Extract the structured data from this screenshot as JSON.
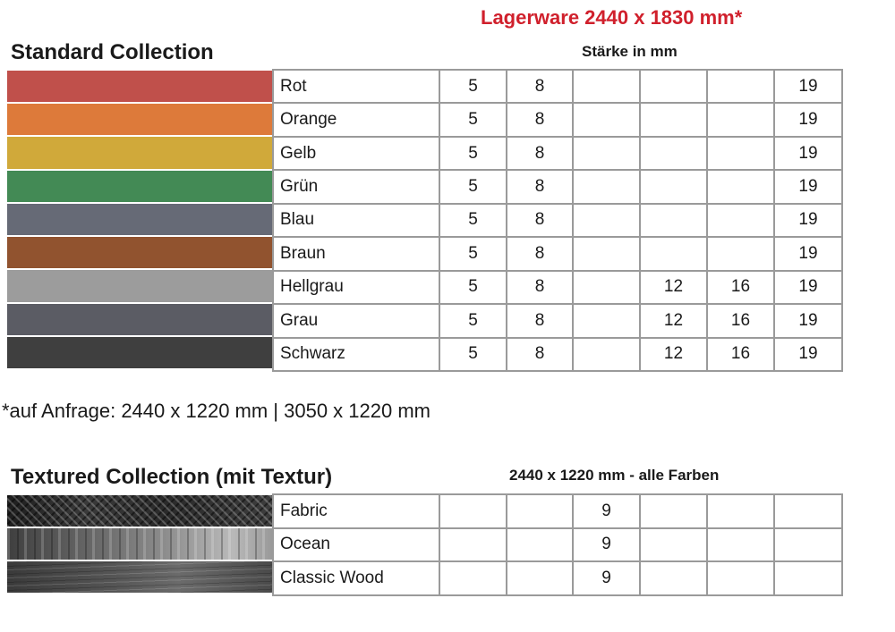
{
  "header": {
    "stock_title": "Lagerware 2440 x 1830 mm*",
    "thickness_label": "Stärke in mm"
  },
  "standard": {
    "title": "Standard Collection",
    "rows": [
      {
        "name": "Rot",
        "swatch": "#c0504b",
        "cells": [
          "5",
          "8",
          "",
          "",
          "",
          "19"
        ]
      },
      {
        "name": "Orange",
        "swatch": "#dd7a3a",
        "cells": [
          "5",
          "8",
          "",
          "",
          "",
          "19"
        ]
      },
      {
        "name": "Gelb",
        "swatch": "#d0a93a",
        "cells": [
          "5",
          "8",
          "",
          "",
          "",
          "19"
        ]
      },
      {
        "name": "Grün",
        "swatch": "#438a55",
        "cells": [
          "5",
          "8",
          "",
          "",
          "",
          "19"
        ]
      },
      {
        "name": "Blau",
        "swatch": "#666a76",
        "cells": [
          "5",
          "8",
          "",
          "",
          "",
          "19"
        ]
      },
      {
        "name": "Braun",
        "swatch": "#91532f",
        "cells": [
          "5",
          "8",
          "",
          "",
          "",
          "19"
        ]
      },
      {
        "name": "Hellgrau",
        "swatch": "#9c9c9c",
        "cells": [
          "5",
          "8",
          "",
          "12",
          "16",
          "19"
        ]
      },
      {
        "name": "Grau",
        "swatch": "#5b5c64",
        "cells": [
          "5",
          "8",
          "",
          "12",
          "16",
          "19"
        ]
      },
      {
        "name": "Schwarz",
        "swatch": "#3f3f3f",
        "cells": [
          "5",
          "8",
          "",
          "12",
          "16",
          "19"
        ]
      }
    ]
  },
  "note": "*auf Anfrage: 2440 x 1220 mm  |  3050 x 1220 mm",
  "textured": {
    "title": "Textured Collection (mit Textur)",
    "size_label": "2440 x 1220 mm - alle Farben",
    "rows": [
      {
        "name": "Fabric",
        "texture": "fabric",
        "cells": [
          "",
          "",
          "9",
          "",
          "",
          ""
        ]
      },
      {
        "name": "Ocean",
        "texture": "ocean",
        "cells": [
          "",
          "",
          "9",
          "",
          "",
          ""
        ]
      },
      {
        "name": "Classic Wood",
        "texture": "wood",
        "cells": [
          "",
          "",
          "9",
          "",
          "",
          ""
        ]
      }
    ]
  }
}
